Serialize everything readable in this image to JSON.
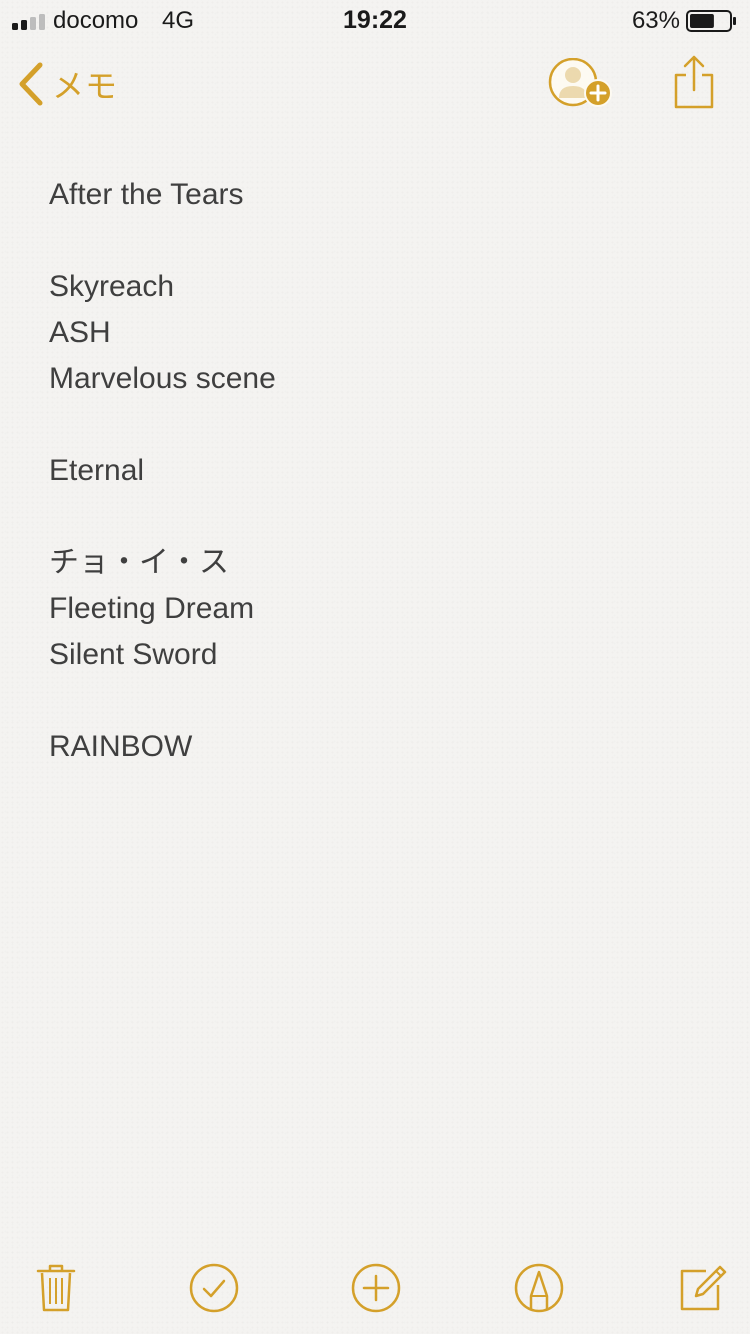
{
  "status_bar": {
    "carrier": "docomo",
    "network": "4G",
    "time": "19:22",
    "battery_percent": "63%",
    "battery_level": 0.63,
    "signal_bars_filled": 2,
    "signal_bars_total": 4
  },
  "nav": {
    "back_label": "メモ",
    "back_icon": "chevron-left-icon",
    "add_people_icon": "add-person-icon",
    "share_icon": "share-icon"
  },
  "note": {
    "lines": [
      "After the Tears",
      "",
      "Skyreach",
      "ASH",
      "Marvelous scene",
      "",
      "Eternal",
      "",
      "チョ・イ・ス",
      "Fleeting Dream",
      "Silent Sword",
      "",
      "RAINBOW"
    ]
  },
  "toolbar": {
    "delete_icon": "trash-icon",
    "checklist_icon": "checkmark-circle-icon",
    "add_icon": "plus-circle-icon",
    "sketch_icon": "pen-tip-circle-icon",
    "compose_icon": "compose-icon"
  },
  "colors": {
    "accent": "#d4a02a",
    "text": "#3f3f3f",
    "background": "#f4f3f1"
  }
}
